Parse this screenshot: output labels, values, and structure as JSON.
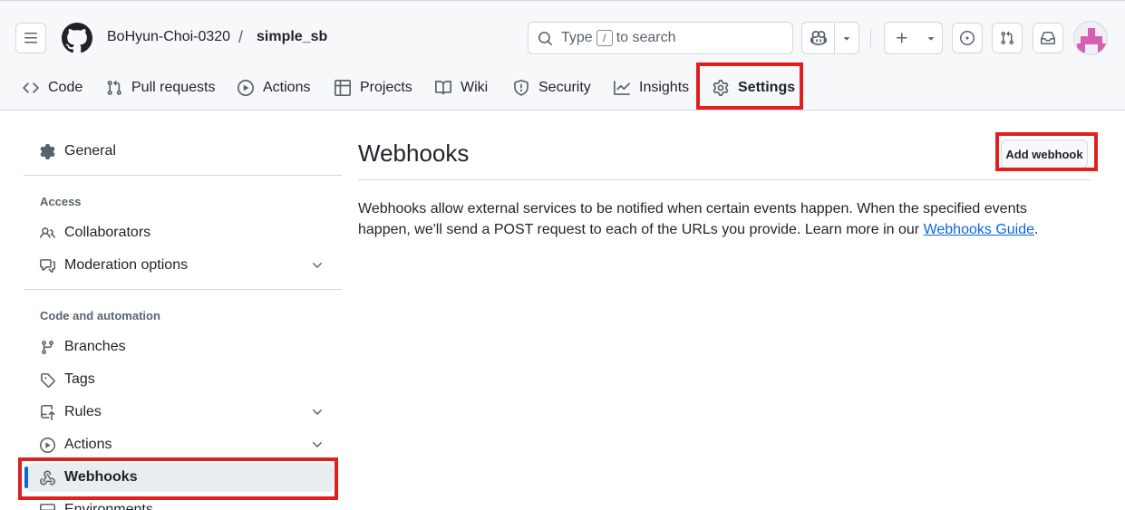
{
  "header": {
    "owner": "BoHyun-Choi-0320",
    "separator": "/",
    "repo": "simple_sb",
    "search_before": "Type",
    "search_key": "/",
    "search_after": "to search"
  },
  "tabs": [
    {
      "label": "Code",
      "icon": "code-icon"
    },
    {
      "label": "Pull requests",
      "icon": "git-pull-request-icon"
    },
    {
      "label": "Actions",
      "icon": "play-icon"
    },
    {
      "label": "Projects",
      "icon": "table-icon"
    },
    {
      "label": "Wiki",
      "icon": "book-icon"
    },
    {
      "label": "Security",
      "icon": "shield-icon"
    },
    {
      "label": "Insights",
      "icon": "graph-icon"
    },
    {
      "label": "Settings",
      "icon": "gear-icon",
      "selected": true
    }
  ],
  "sidebar": {
    "general": "General",
    "access_heading": "Access",
    "collaborators": "Collaborators",
    "moderation": "Moderation options",
    "code_heading": "Code and automation",
    "branches": "Branches",
    "tags": "Tags",
    "rules": "Rules",
    "actions": "Actions",
    "webhooks": "Webhooks",
    "environments": "Environments"
  },
  "main": {
    "title": "Webhooks",
    "add_button": "Add webhook",
    "description_1": "Webhooks allow external services to be notified when certain events happen. When the specified events happen, we'll send a POST request to each of the URLs you provide. Learn more in our ",
    "link_text": "Webhooks Guide",
    "description_2": "."
  },
  "colors": {
    "highlight": "#e02020",
    "accent": "#0969da",
    "tab_underline": "#fd8c73",
    "avatar": "#d45fb5"
  }
}
